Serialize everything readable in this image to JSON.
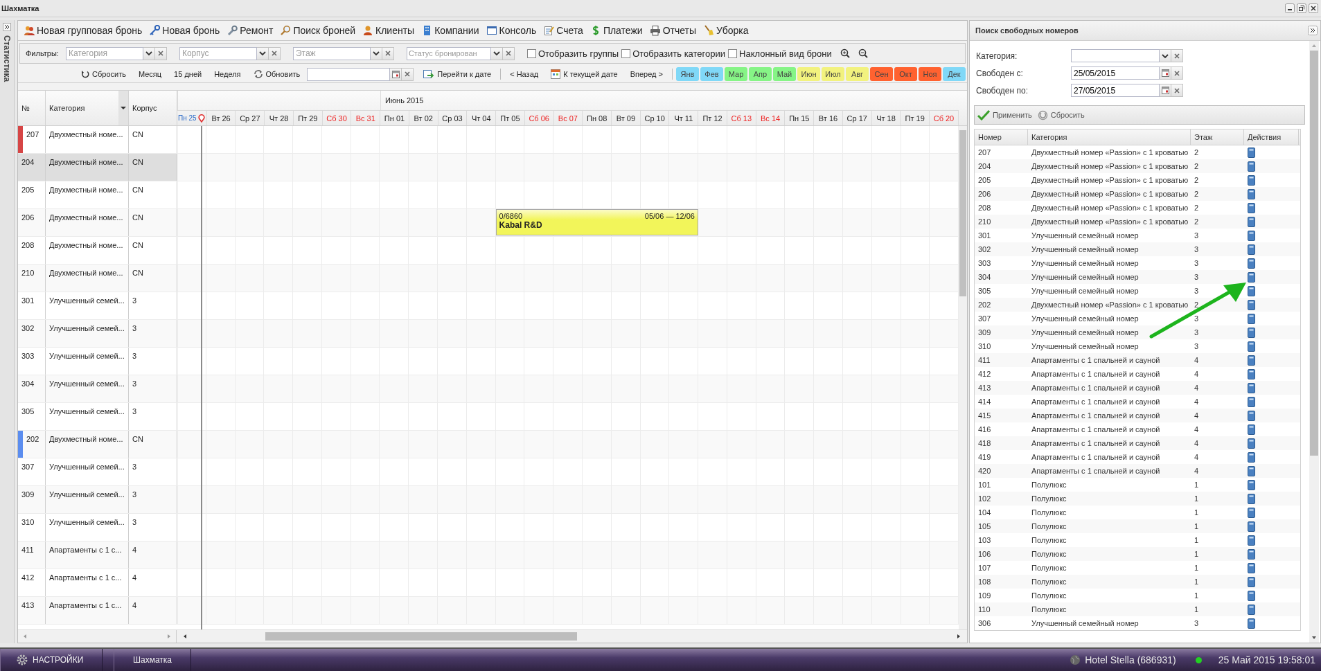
{
  "window": {
    "title": "Шахматка"
  },
  "sidebar_tab": {
    "label": "Статистика"
  },
  "toolbar": [
    {
      "label": "Новая групповая бронь"
    },
    {
      "label": "Новая бронь"
    },
    {
      "label": "Ремонт"
    },
    {
      "label": "Поиск броней"
    },
    {
      "label": "Клиенты"
    },
    {
      "label": "Компании"
    },
    {
      "label": "Консоль"
    },
    {
      "label": "Счета"
    },
    {
      "label": "Платежи"
    },
    {
      "label": "Отчеты"
    },
    {
      "label": "Уборка"
    }
  ],
  "filters": {
    "label": "Фильтры:",
    "combos": [
      {
        "placeholder": "Категория"
      },
      {
        "placeholder": "Корпус"
      },
      {
        "placeholder": "Этаж"
      },
      {
        "placeholder": "Статус бронирован"
      }
    ],
    "checkboxes": [
      {
        "label": "Отобразить группы",
        "checked": false
      },
      {
        "label": "Отобразить категории",
        "checked": false
      },
      {
        "label": "Наклонный вид брони",
        "checked": false
      }
    ]
  },
  "nav": {
    "reset": "Сбросить",
    "views": [
      {
        "label": "Месяц"
      },
      {
        "label": "15 дней"
      },
      {
        "label": "Неделя"
      }
    ],
    "refresh": "Обновить",
    "goto": "Перейти к дате",
    "back": "< Назад",
    "today": "К текущей дате",
    "forward": "Вперед >",
    "months": [
      {
        "label": "Янв",
        "color": "#80d8f7"
      },
      {
        "label": "Фев",
        "color": "#80d8f7"
      },
      {
        "label": "Мар",
        "color": "#86f486"
      },
      {
        "label": "Апр",
        "color": "#86f486"
      },
      {
        "label": "Май",
        "color": "#86f486"
      },
      {
        "label": "Июн",
        "color": "#f2f27e"
      },
      {
        "label": "Июл",
        "color": "#f2f27e"
      },
      {
        "label": "Авг",
        "color": "#f2f27e"
      },
      {
        "label": "Сен",
        "color": "#ff6230"
      },
      {
        "label": "Окт",
        "color": "#ff6230"
      },
      {
        "label": "Ноя",
        "color": "#ff6230"
      },
      {
        "label": "Дек",
        "color": "#80d8f7"
      }
    ]
  },
  "grid": {
    "columns": [
      "№",
      "Категория",
      "Корпус"
    ],
    "day_groups": [
      {
        "days": [
          {
            "label": "Пн 25",
            "kind": "today"
          },
          {
            "label": "Вт 26",
            "kind": "weekday"
          },
          {
            "label": "Ср 27",
            "kind": "weekday"
          },
          {
            "label": "Чт 28",
            "kind": "weekday"
          },
          {
            "label": "Пт 29",
            "kind": "weekday"
          },
          {
            "label": "Сб 30",
            "kind": "weekend"
          },
          {
            "label": "Вс 31",
            "kind": "weekend"
          }
        ]
      },
      {
        "label": "Июнь 2015",
        "days": [
          {
            "label": "Пн 01",
            "kind": "weekday"
          },
          {
            "label": "Вт 02",
            "kind": "weekday"
          },
          {
            "label": "Ср 03",
            "kind": "weekday"
          },
          {
            "label": "Чт 04",
            "kind": "weekday"
          },
          {
            "label": "Пт 05",
            "kind": "weekday"
          },
          {
            "label": "Сб 06",
            "kind": "weekend"
          },
          {
            "label": "Вс 07",
            "kind": "weekend"
          },
          {
            "label": "Пн 08",
            "kind": "weekday"
          },
          {
            "label": "Вт 09",
            "kind": "weekday"
          },
          {
            "label": "Ср 10",
            "kind": "weekday"
          },
          {
            "label": "Чт 11",
            "kind": "weekday"
          },
          {
            "label": "Пт 12",
            "kind": "weekday"
          },
          {
            "label": "Сб 13",
            "kind": "weekend"
          },
          {
            "label": "Вс 14",
            "kind": "weekend"
          },
          {
            "label": "Пн 15",
            "kind": "weekday"
          },
          {
            "label": "Вт 16",
            "kind": "weekday"
          },
          {
            "label": "Ср 17",
            "kind": "weekday"
          },
          {
            "label": "Чт 18",
            "kind": "weekday"
          },
          {
            "label": "Пт 19",
            "kind": "weekday"
          },
          {
            "label": "Сб 20",
            "kind": "weekend"
          }
        ]
      }
    ],
    "rows": [
      {
        "number": "207",
        "category": "Двухместный номе...",
        "building": "CN",
        "selected": false,
        "color": "#d64545"
      },
      {
        "number": "204",
        "category": "Двухместный номе...",
        "building": "CN",
        "selected": true
      },
      {
        "number": "205",
        "category": "Двухместный номе...",
        "building": "CN",
        "selected": false
      },
      {
        "number": "206",
        "category": "Двухместный номе...",
        "building": "CN",
        "selected": false,
        "slots": [
          {
            "kind": "free"
          },
          {
            "kind": "free"
          },
          {
            "kind": "free"
          },
          {
            "kind": "free"
          },
          {
            "kind": "free"
          },
          {
            "kind": "free"
          },
          {
            "kind": "free"
          },
          {
            "kind": "free"
          },
          {
            "kind": "free"
          },
          {
            "kind": "free"
          },
          {
            "kind": "free"
          },
          {
            "kind": "booking",
            "code": "0/6860",
            "dates": "05/06 — 12/06",
            "guest": "Kabal R&D"
          },
          {
            "kind": "booked"
          },
          {
            "kind": "booked"
          },
          {
            "kind": "booked"
          },
          {
            "kind": "booked"
          },
          {
            "kind": "booked"
          },
          {
            "kind": "booked"
          }
        ]
      },
      {
        "number": "208",
        "category": "Двухместный номе...",
        "building": "CN",
        "selected": false
      },
      {
        "number": "210",
        "category": "Двухместный номе...",
        "building": "CN",
        "selected": false
      },
      {
        "number": "301",
        "category": "Улучшенный семей...",
        "building": "3",
        "selected": false
      },
      {
        "number": "302",
        "category": "Улучшенный семей...",
        "building": "3",
        "selected": false
      },
      {
        "number": "303",
        "category": "Улучшенный семей...",
        "building": "3",
        "selected": false
      },
      {
        "number": "304",
        "category": "Улучшенный семей...",
        "building": "3",
        "selected": false
      },
      {
        "number": "305",
        "category": "Улучшенный семей...",
        "building": "3",
        "selected": false
      },
      {
        "number": "202",
        "category": "Двухместный номе...",
        "building": "CN",
        "selected": false,
        "color": "#5b8def"
      },
      {
        "number": "307",
        "category": "Улучшенный семей...",
        "building": "3",
        "selected": false
      },
      {
        "number": "309",
        "category": "Улучшенный семей...",
        "building": "3",
        "selected": false
      },
      {
        "number": "310",
        "category": "Улучшенный семей...",
        "building": "3",
        "selected": false
      },
      {
        "number": "411",
        "category": "Апартаменты с 1 с...",
        "building": "4",
        "selected": false
      },
      {
        "number": "412",
        "category": "Апартаменты с 1 с...",
        "building": "4",
        "selected": false
      },
      {
        "number": "413",
        "category": "Апартаменты с 1 с...",
        "building": "4",
        "selected": false
      }
    ]
  },
  "search_panel": {
    "title": "Поиск свободных номеров",
    "fields": [
      {
        "label": "Категория:",
        "kind": "combo"
      },
      {
        "label": "Свободен с:",
        "kind": "date",
        "value": "25/05/2015"
      },
      {
        "label": "Свободен по:",
        "kind": "date",
        "value": "27/05/2015"
      }
    ],
    "apply": "Применить",
    "reset": "Сбросить",
    "columns": [
      "Номер",
      "Категория",
      "Этаж",
      "Действия"
    ],
    "rows": [
      {
        "number": "207",
        "category": "Двухместный номер «Passion» с 1 кроватью",
        "floor": "2"
      },
      {
        "number": "204",
        "category": "Двухместный номер «Passion» с 1 кроватью",
        "floor": "2"
      },
      {
        "number": "205",
        "category": "Двухместный номер «Passion» с 1 кроватью",
        "floor": "2"
      },
      {
        "number": "206",
        "category": "Двухместный номер «Passion» с 1 кроватью",
        "floor": "2"
      },
      {
        "number": "208",
        "category": "Двухместный номер «Passion» с 1 кроватью",
        "floor": "2"
      },
      {
        "number": "210",
        "category": "Двухместный номер «Passion» с 1 кроватью",
        "floor": "2"
      },
      {
        "number": "301",
        "category": "Улучшенный семейный номер",
        "floor": "3"
      },
      {
        "number": "302",
        "category": "Улучшенный семейный номер",
        "floor": "3"
      },
      {
        "number": "303",
        "category": "Улучшенный семейный номер",
        "floor": "3"
      },
      {
        "number": "304",
        "category": "Улучшенный семейный номер",
        "floor": "3"
      },
      {
        "number": "305",
        "category": "Улучшенный семейный номер",
        "floor": "3"
      },
      {
        "number": "202",
        "category": "Двухместный номер «Passion» с 1 кроватью",
        "floor": "2"
      },
      {
        "number": "307",
        "category": "Улучшенный семейный номер",
        "floor": "3"
      },
      {
        "number": "309",
        "category": "Улучшенный семейный номер",
        "floor": "3"
      },
      {
        "number": "310",
        "category": "Улучшенный семейный номер",
        "floor": "3"
      },
      {
        "number": "411",
        "category": "Апартаменты с 1 спальней и сауной",
        "floor": "4"
      },
      {
        "number": "412",
        "category": "Апартаменты с 1 спальней и сауной",
        "floor": "4"
      },
      {
        "number": "413",
        "category": "Апартаменты с 1 спальней и сауной",
        "floor": "4"
      },
      {
        "number": "414",
        "category": "Апартаменты с 1 спальней и сауной",
        "floor": "4"
      },
      {
        "number": "415",
        "category": "Апартаменты с 1 спальней и сауной",
        "floor": "4"
      },
      {
        "number": "416",
        "category": "Апартаменты с 1 спальней и сауной",
        "floor": "4"
      },
      {
        "number": "418",
        "category": "Апартаменты с 1 спальней и сауной",
        "floor": "4"
      },
      {
        "number": "419",
        "category": "Апартаменты с 1 спальней и сауной",
        "floor": "4"
      },
      {
        "number": "420",
        "category": "Апартаменты с 1 спальней и сауной",
        "floor": "4"
      },
      {
        "number": "101",
        "category": "Полулюкс",
        "floor": "1"
      },
      {
        "number": "102",
        "category": "Полулюкс",
        "floor": "1"
      },
      {
        "number": "104",
        "category": "Полулюкс",
        "floor": "1"
      },
      {
        "number": "105",
        "category": "Полулюкс",
        "floor": "1"
      },
      {
        "number": "103",
        "category": "Полулюкс",
        "floor": "1"
      },
      {
        "number": "106",
        "category": "Полулюкс",
        "floor": "1"
      },
      {
        "number": "107",
        "category": "Полулюкс",
        "floor": "1"
      },
      {
        "number": "108",
        "category": "Полулюкс",
        "floor": "1"
      },
      {
        "number": "109",
        "category": "Полулюкс",
        "floor": "1"
      },
      {
        "number": "110",
        "category": "Полулюкс",
        "floor": "1"
      },
      {
        "number": "306",
        "category": "Улучшенный семейный номер",
        "floor": "3"
      }
    ]
  },
  "taskbar": {
    "start": "НАСТРОЙКИ",
    "tasks": [
      {
        "label": "Шахматка"
      }
    ],
    "hotel": "Hotel Stella (686931)",
    "online": true,
    "clock": "25 Май 2015 19:58:01"
  }
}
